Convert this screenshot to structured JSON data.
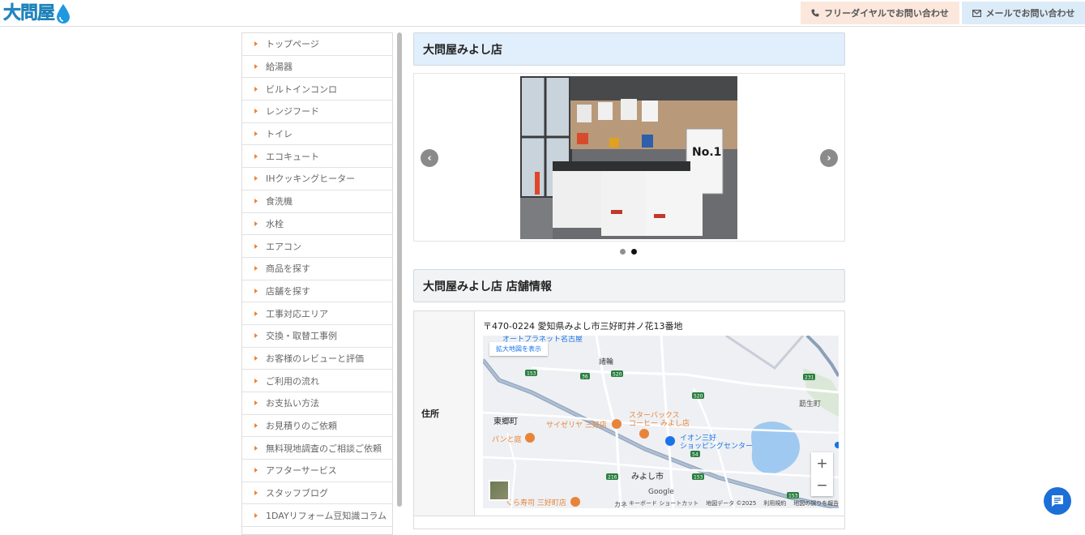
{
  "header": {
    "logo_text": "大問屋",
    "phone_label": "フリーダイヤルでお問い合わせ",
    "mail_label": "メールでお問い合わせ"
  },
  "sidebar": {
    "items": [
      {
        "label": "トップページ"
      },
      {
        "label": "給湯器"
      },
      {
        "label": "ビルトインコンロ"
      },
      {
        "label": "レンジフード"
      },
      {
        "label": "トイレ"
      },
      {
        "label": "エコキュート"
      },
      {
        "label": "IHクッキングヒーター"
      },
      {
        "label": "食洗機"
      },
      {
        "label": "水栓"
      },
      {
        "label": "エアコン"
      },
      {
        "label": "商品を探す"
      },
      {
        "label": "店舗を探す"
      },
      {
        "label": "工事対応エリア"
      },
      {
        "label": "交換・取替工事例"
      },
      {
        "label": "お客様のレビューと評価"
      },
      {
        "label": "ご利用の流れ"
      },
      {
        "label": "お支払い方法"
      },
      {
        "label": "お見積りのご依頼"
      },
      {
        "label": "無料現地調査のご相談ご依頼"
      },
      {
        "label": "アフターサービス"
      },
      {
        "label": "スタッフブログ"
      },
      {
        "label": "1DAYリフォーム豆知識コラム"
      }
    ]
  },
  "main": {
    "store_title": "大問屋みよし店",
    "info_title": "大問屋みよし店 店舗情報",
    "carousel": {
      "prev": "‹",
      "next": "›",
      "slide_count": 2,
      "active_slide": 2
    },
    "info": {
      "address_label": "住所",
      "address_value": "〒470-0224 愛知県みよし市三好町井ノ花13番地"
    },
    "map": {
      "enlarge_link": "拡大地図を表示",
      "zoom_in": "+",
      "zoom_out": "−",
      "labels": {
        "auto_planet": "オートプラネット名古屋",
        "suwa": "諸輪",
        "higashigo": "東郷町",
        "saizeriya": "サイゼリヤ 三好店",
        "starbucks_1": "スターバックス",
        "starbucks_2": "コーヒー みよし店",
        "aeon_1": "イオン三好",
        "aeon_2": "ショッピングセンター",
        "pan": "パンと庭",
        "miyoshi": "みよし市",
        "kura": "くら寿司 三好町店",
        "haginocho": "莇生町",
        "google": "Google",
        "ka": "カネ"
      },
      "roads": [
        "153",
        "36",
        "520",
        "520",
        "54",
        "153",
        "231",
        "216",
        "153"
      ],
      "footer": [
        "キーボード ショートカット",
        "地図データ ©2025",
        "利用規約",
        "地図の誤りを報告する"
      ]
    }
  },
  "colors": {
    "accent_orange": "#e8843a",
    "title_blue_bg": "#e1eefb",
    "phone_bg": "#fbe7dc",
    "mail_bg": "#dcebf8",
    "chat_blue": "#1c6fd6"
  },
  "icons": {
    "phone": "phone-icon",
    "mail": "mail-icon",
    "chat": "chat-icon",
    "drop": "water-drop-icon"
  }
}
